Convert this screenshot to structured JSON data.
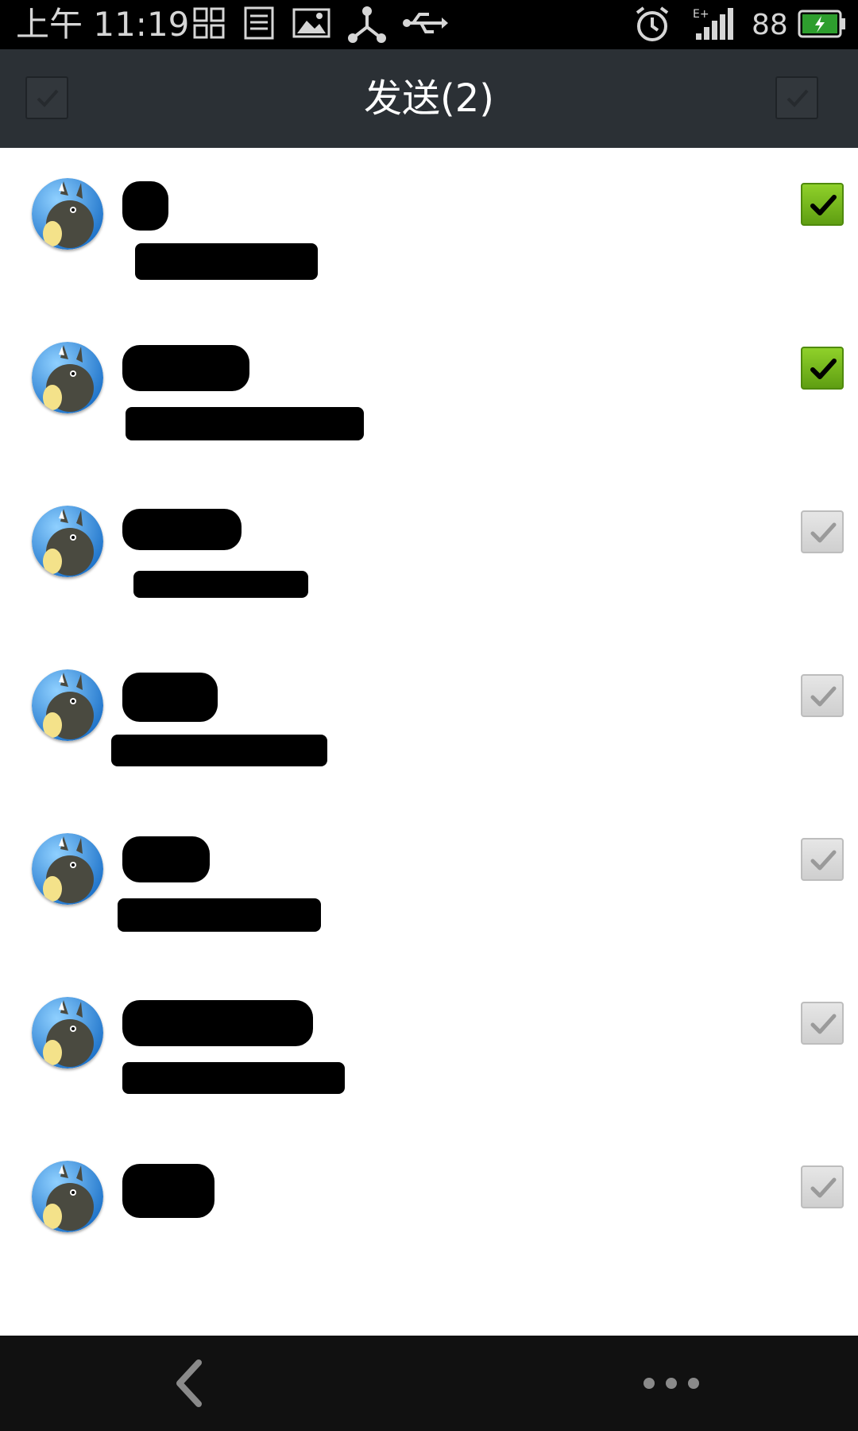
{
  "status_bar": {
    "time": "上午 11:19",
    "battery_level": "88",
    "icons": [
      "grid-icon",
      "notes-icon",
      "gallery-icon",
      "share-icon",
      "usb-icon",
      "alarm-icon",
      "signal-icon",
      "battery-icon"
    ]
  },
  "header": {
    "title": "发送(2)"
  },
  "contacts": [
    {
      "name": "",
      "subtitle": "",
      "checked": true
    },
    {
      "name": "",
      "subtitle": "",
      "checked": true
    },
    {
      "name": "",
      "subtitle": "",
      "checked": false
    },
    {
      "name": "",
      "subtitle": "",
      "checked": false
    },
    {
      "name": "",
      "subtitle": "",
      "checked": false
    },
    {
      "name": "",
      "subtitle": "",
      "checked": false
    },
    {
      "name": "",
      "subtitle": "",
      "checked": false
    }
  ],
  "bottom_bar": {
    "icons": [
      "back-icon",
      "more-icon"
    ]
  },
  "colors": {
    "title_bar": "#2b3035",
    "checked_green": "#6fb41a",
    "status_bar": "#000000",
    "bottom_bar": "#111111"
  }
}
